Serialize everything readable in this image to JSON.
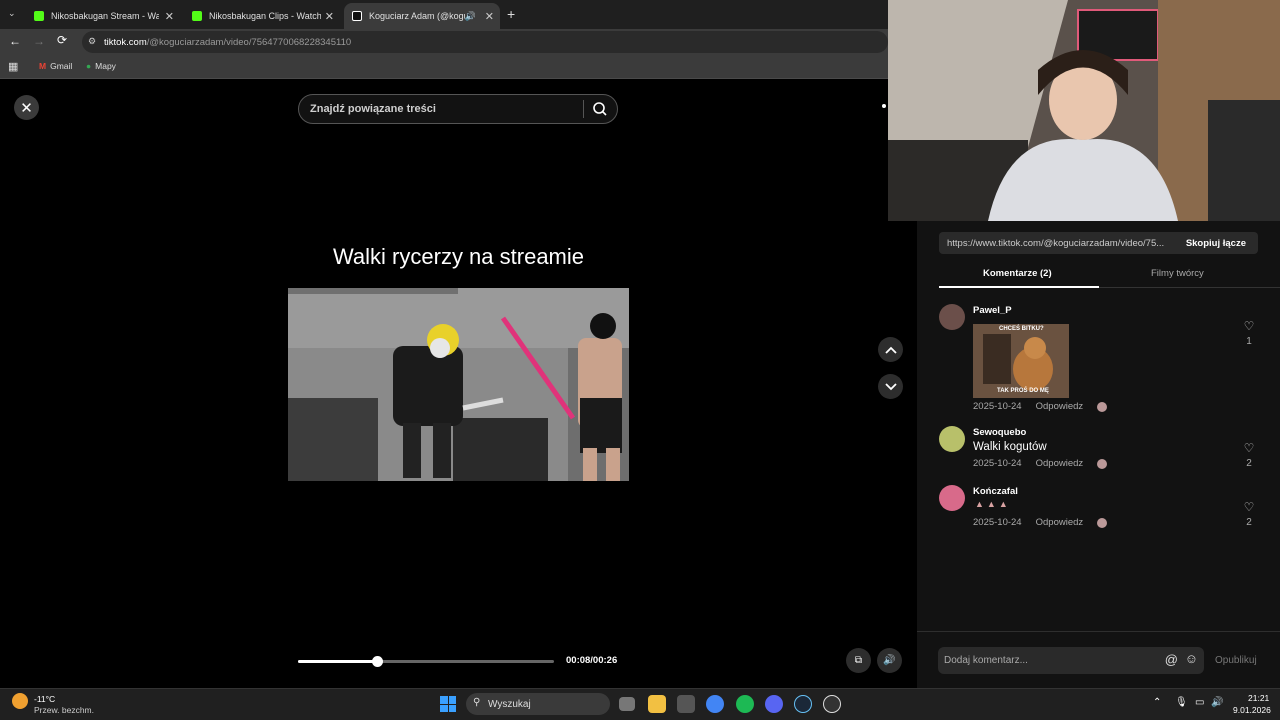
{
  "browser": {
    "tabs": [
      {
        "label": "Nikosbakugan Stream - Watch L"
      },
      {
        "label": "Nikosbakugan Clips - Watch Liv"
      },
      {
        "label": "Koguciarz Adam (@kogucia"
      }
    ],
    "url_domain": "tiktok.com",
    "url_path": "/@koguciarzadam/video/7564770068228345110",
    "bookmarks": [
      {
        "label": "Gmail"
      },
      {
        "label": "Mapy"
      }
    ]
  },
  "search": {
    "placeholder": "Znajdź powiązane treści"
  },
  "video": {
    "title": "Walki rycerzy na streamie",
    "time": "00:08/00:26",
    "progress_fraction": 0.31
  },
  "panel": {
    "link_url": "https://www.tiktok.com/@koguciarzadam/video/75...",
    "copy_label": "Skopiuj łącze",
    "tabs": [
      {
        "label": "Komentarze (2)"
      },
      {
        "label": "Filmy twórcy"
      }
    ],
    "comments": [
      {
        "user": "Pawel_P",
        "text": "",
        "date": "2025-10-24",
        "reply": "Odpowiedz",
        "likes": "1",
        "gif_caption_top": "CHCEŚ BITKU?",
        "gif_caption_bottom": "TAK PROŚ DO MĘ"
      },
      {
        "user": "Sewoquebo",
        "text": "Walki kogutów",
        "date": "2025-10-24",
        "reply": "Odpowiedz",
        "likes": "2"
      },
      {
        "user": "Kończafal",
        "text": "",
        "date": "2025-10-24",
        "reply": "Odpowiedz",
        "likes": "2"
      }
    ],
    "comment_placeholder": "Dodaj komentarz...",
    "publish_label": "Opublikuj"
  },
  "taskbar": {
    "weather_temp": "-11°C",
    "weather_desc": "Przew. bezchm.",
    "search_placeholder": "Wyszukaj",
    "time": "21:21",
    "date": "9.01.2026"
  },
  "colors": {
    "accent_green": "#53fc18",
    "tiktok_pink": "#fe2c55"
  }
}
